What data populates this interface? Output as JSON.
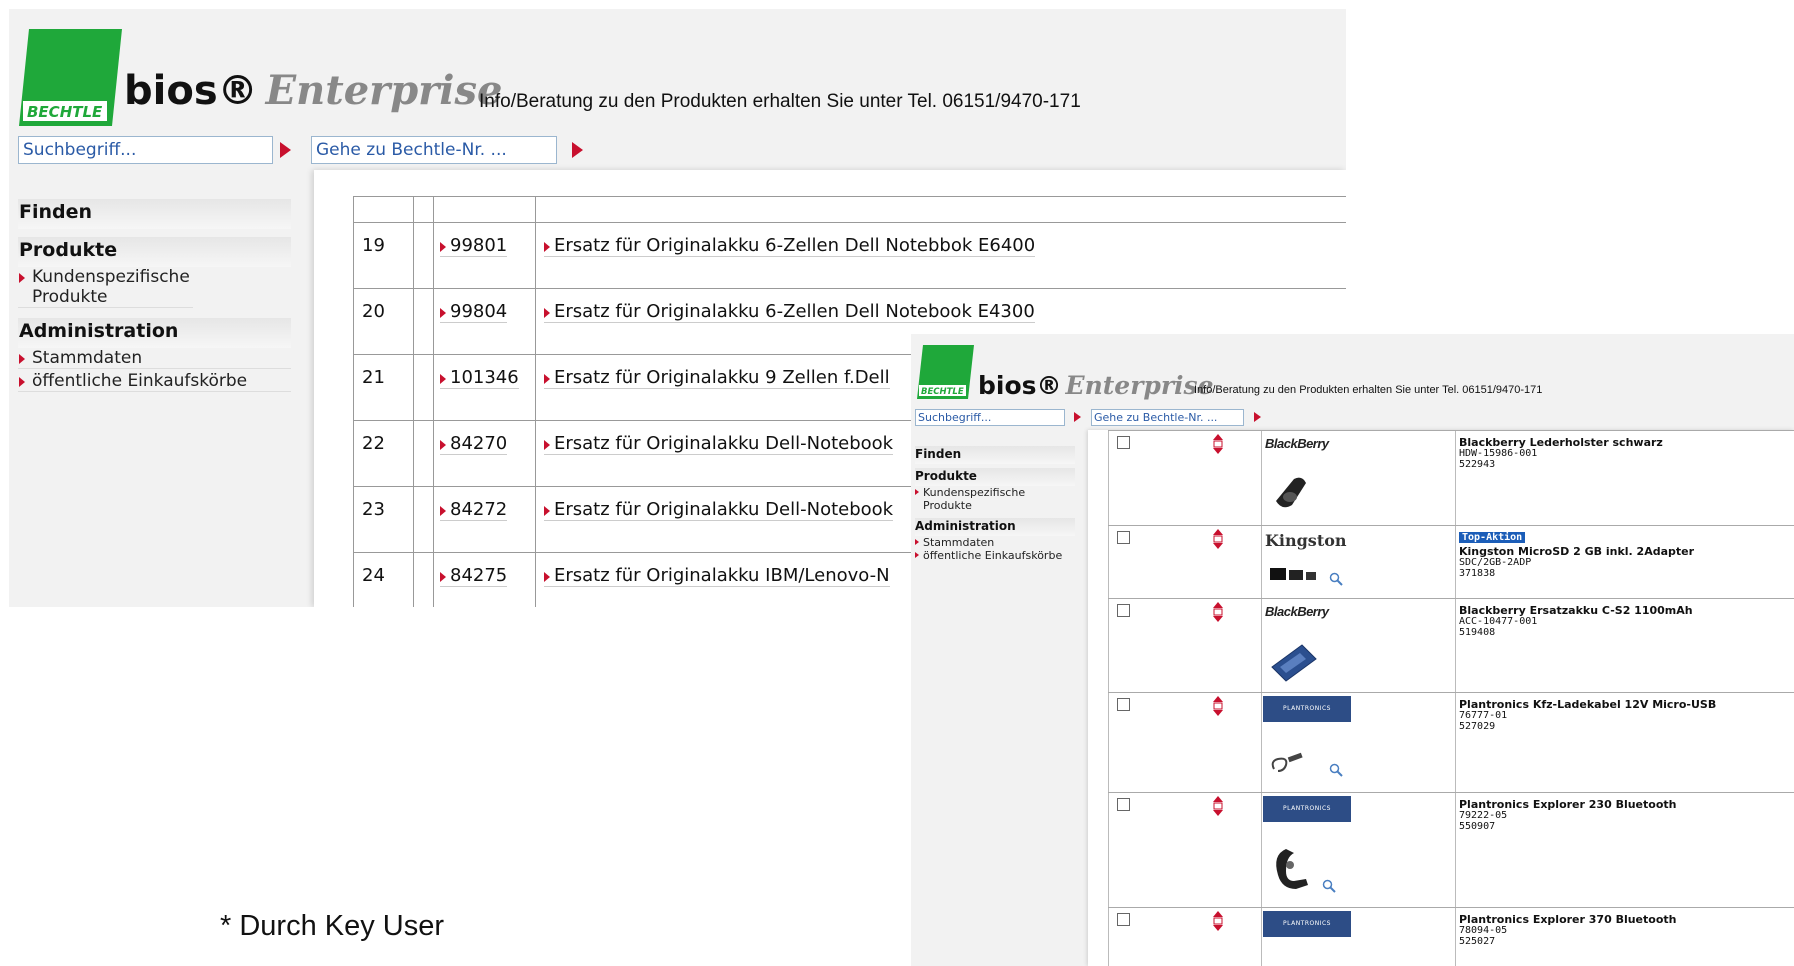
{
  "colors": {
    "accent_red": "#c8102e",
    "bechtle_green": "#1fa83a",
    "plantronics_blue": "#2d4d86"
  },
  "screenshot1": {
    "brand": {
      "logo_text": "BECHTLE",
      "bios": "bios®",
      "enterprise": "Enterprise"
    },
    "info": "Info/Beratung zu den Produkten erhalten Sie unter Tel. 06151/9470-171",
    "search_value": "Suchbegriff...",
    "goto_value": "Gehe zu Bechtle-Nr. ...",
    "sidebar": {
      "finden": "Finden",
      "produkte": "Produkte",
      "kundenspezifische": "Kundenspezifische Produkte",
      "administration": "Administration",
      "stammdaten": "Stammdaten",
      "einkaufskoerbe": "öffentliche Einkaufskörbe"
    },
    "rows": [
      {
        "no": "19",
        "id": "99801",
        "desc": "Ersatz für Originalakku 6-Zellen Dell Notebbok E6400"
      },
      {
        "no": "20",
        "id": "99804",
        "desc": "Ersatz für Originalakku 6-Zellen Dell Notebook E4300"
      },
      {
        "no": "21",
        "id": "101346",
        "desc": "Ersatz für Originalakku 9 Zellen f.Dell"
      },
      {
        "no": "22",
        "id": "84270",
        "desc": "Ersatz für Originalakku Dell-Notebook"
      },
      {
        "no": "23",
        "id": "84272",
        "desc": "Ersatz für Originalakku Dell-Notebook"
      },
      {
        "no": "24",
        "id": "84275",
        "desc": "Ersatz für Originalakku IBM/Lenovo-N"
      }
    ]
  },
  "screenshot2": {
    "brand": {
      "logo_text": "BECHTLE",
      "bios": "bios®",
      "enterprise": "Enterprise"
    },
    "info": "Info/Beratung zu den Produkten erhalten Sie unter Tel. 06151/9470-171",
    "search_value": "Suchbegriff...",
    "goto_value": "Gehe zu Bechtle-Nr. ...",
    "sidebar": {
      "finden": "Finden",
      "produkte": "Produkte",
      "kundenspezifische": "Kundenspezifische Produkte",
      "administration": "Administration",
      "stammdaten": "Stammdaten",
      "einkaufskoerbe": "öffentliche Einkaufskörbe"
    },
    "products": [
      {
        "brand": "BlackBerry",
        "badge": "",
        "name": "Blackberry Lederholster schwarz",
        "sku": "HDW-15986-001",
        "nr": "522943"
      },
      {
        "brand": "Kingston",
        "badge": "Top-Aktion",
        "name": "Kingston MicroSD 2 GB inkl. 2Adapter",
        "sku": "SDC/2GB-2ADP",
        "nr": "371838"
      },
      {
        "brand": "BlackBerry",
        "badge": "",
        "name": "Blackberry Ersatzakku C-S2 1100mAh",
        "sku": "ACC-10477-001",
        "nr": "519408"
      },
      {
        "brand": "PLANTRONICS",
        "badge": "",
        "name": "Plantronics Kfz-Ladekabel 12V Micro-USB",
        "sku": "76777-01",
        "nr": "527029"
      },
      {
        "brand": "PLANTRONICS",
        "badge": "",
        "name": "Plantronics Explorer 230 Bluetooth",
        "sku": "79222-05",
        "nr": "550907"
      },
      {
        "brand": "PLANTRONICS",
        "badge": "",
        "name": "Plantronics Explorer 370 Bluetooth",
        "sku": "78094-05",
        "nr": "525027"
      }
    ]
  },
  "footnote": "* Durch Key User"
}
